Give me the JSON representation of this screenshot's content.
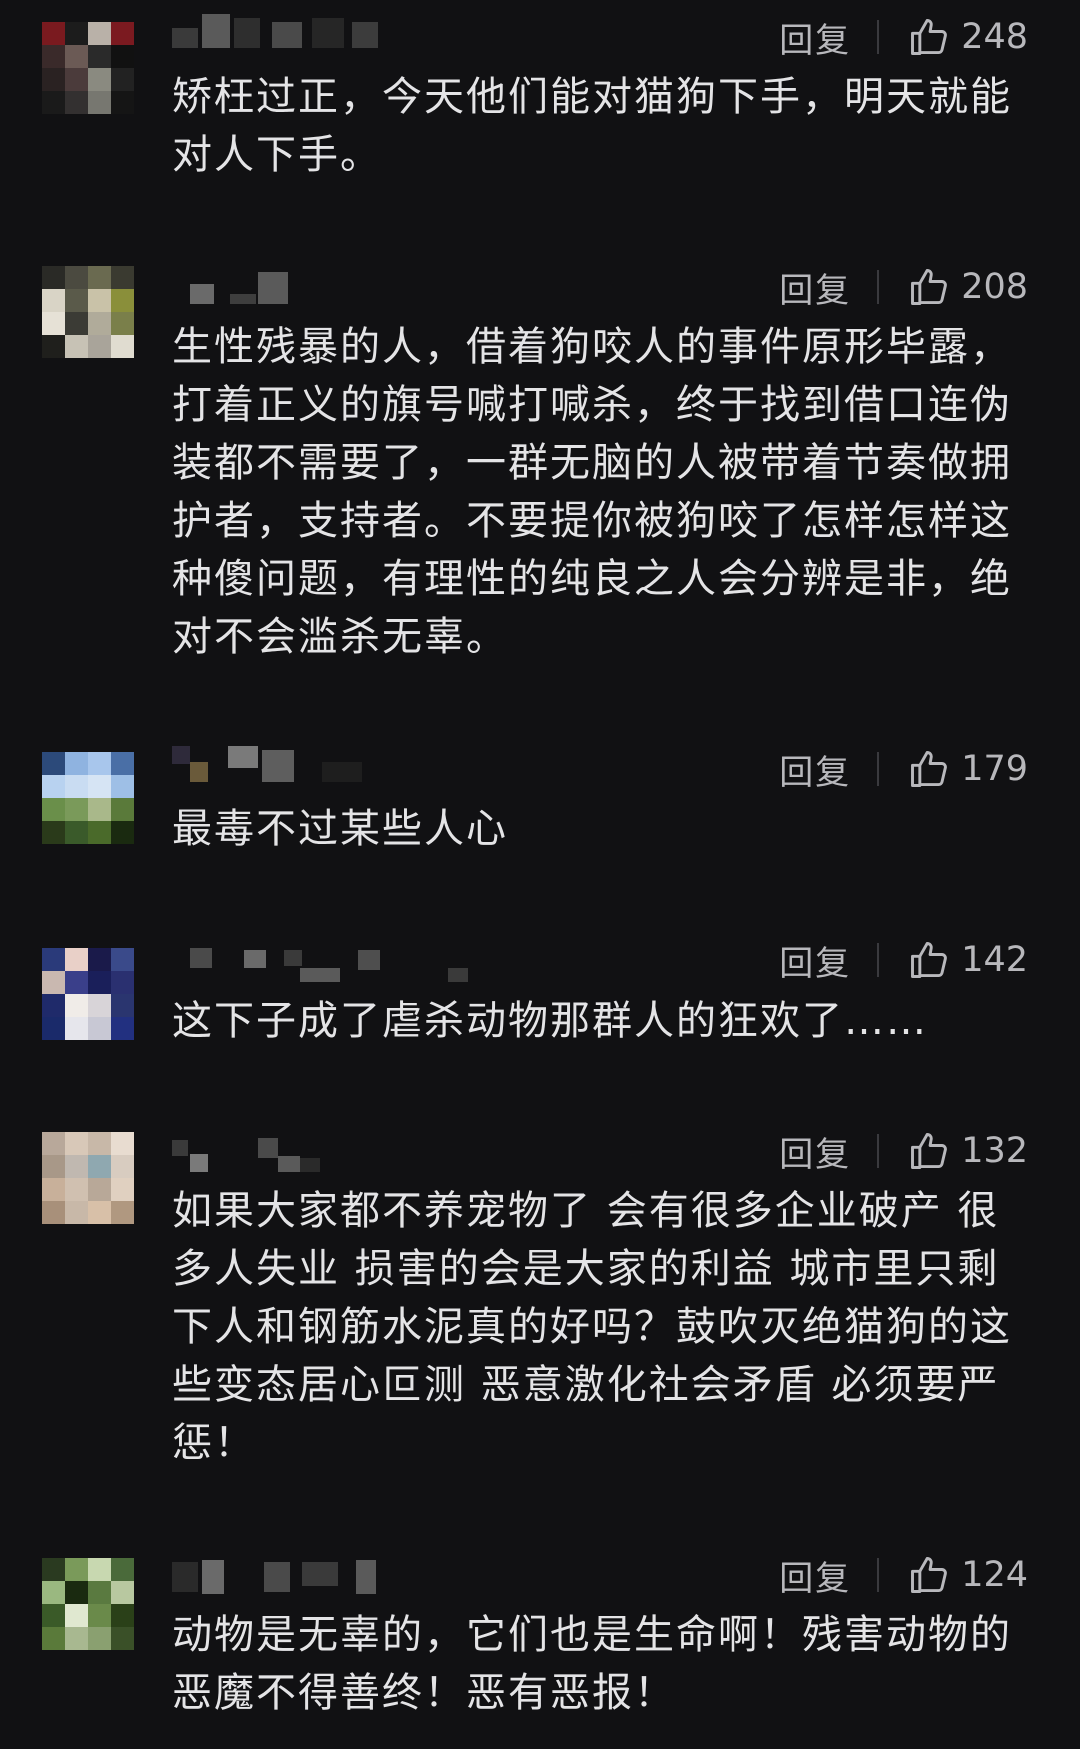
{
  "comments": [
    {
      "text": "矫枉过正，今天他们能对猫狗下手，明天就能对人下手。",
      "reply_label": "回复",
      "likes": "248",
      "avatar": [
        "#7a1a1f",
        "#1c1c1c",
        "#b9b1a8",
        "#7b1a20",
        "#3a2a2a",
        "#6b5a55",
        "#2a2a2a",
        "#111111",
        "#2a2222",
        "#4b3b3b",
        "#8a8a80",
        "#222222",
        "#1a1a1a",
        "#333030",
        "#777770",
        "#151515"
      ]
    },
    {
      "text": "生性残暴的人，借着狗咬人的事件原形毕露，打着正义的旗号喊打喊杀，终于找到借口连伪装都不需要了，一群无脑的人被带着节奏做拥护者，支持者。不要提你被狗咬了怎样怎样这种傻问题，有理性的纯良之人会分辨是非，绝对不会滥杀无辜。",
      "reply_label": "回复",
      "likes": "208",
      "avatar": [
        "#2a2a26",
        "#4b4a40",
        "#6a6a50",
        "#3a3a30",
        "#d9d4c6",
        "#5a5a4a",
        "#c9c2a8",
        "#8a8f3a",
        "#e6e1d6",
        "#3b3b35",
        "#b0ab9a",
        "#7a7f4a",
        "#1f1f1c",
        "#c7c2b5",
        "#a9a49a",
        "#e0dcd0"
      ]
    },
    {
      "text": "最毒不过某些人心",
      "reply_label": "回复",
      "likes": "179",
      "avatar": [
        "#2c4a7a",
        "#8fb3e0",
        "#a8c6ec",
        "#4a6fa6",
        "#b8d2f0",
        "#c9dcf2",
        "#d6e4f4",
        "#9ebfe6",
        "#6a8f4a",
        "#7a9a5a",
        "#a9b88a",
        "#5a7a3a",
        "#2a3a1a",
        "#3a5a2a",
        "#4a6a2a",
        "#1a2a10"
      ]
    },
    {
      "text": "这下子成了虐杀动物那群人的狂欢了……",
      "reply_label": "回复",
      "likes": "142",
      "avatar": [
        "#2a3a7a",
        "#e9d0c8",
        "#1a1a4a",
        "#3a4a8a",
        "#c9b8b0",
        "#3a3f8a",
        "#1a1f5a",
        "#2a3070",
        "#1f2a6a",
        "#f0ece8",
        "#d8d4d8",
        "#2a356f",
        "#1a2a6a",
        "#e6e6ec",
        "#c8c8d4",
        "#223080"
      ]
    },
    {
      "text": "如果大家都不养宠物了 会有很多企业破产 很多人失业 损害的会是大家的利益 城市里只剩下人和钢筋水泥真的好吗？鼓吹灭绝猫狗的这些变态居心叵测 恶意激化社会矛盾 必须要严惩！",
      "reply_label": "回复",
      "likes": "132",
      "avatar": [
        "#b8a89a",
        "#d8c8b8",
        "#c8b8a8",
        "#e8dcd0",
        "#a89888",
        "#c0b8b0",
        "#8fa8b0",
        "#d8ccc0",
        "#c8b09a",
        "#d0c0b0",
        "#b8a898",
        "#e0d0c0",
        "#a8907a",
        "#c8b8a8",
        "#d8c0a8",
        "#b09880"
      ]
    },
    {
      "text": "动物是无辜的，它们也是生命啊！残害动物的恶魔不得善终！恶有恶报！",
      "reply_label": "回复",
      "likes": "124",
      "avatar": [
        "#2a3a20",
        "#7a9a5a",
        "#c8d8b0",
        "#4a6a3a",
        "#9ab880",
        "#1a2a10",
        "#5a7a40",
        "#b8c8a0",
        "#3a5a28",
        "#e0e8d0",
        "#6a8a4a",
        "#2a4018",
        "#5a7a3a",
        "#a8b890",
        "#8aa070",
        "#3a5028"
      ]
    }
  ],
  "icons": {
    "like": "thumbs-up-icon"
  },
  "colors": {
    "background": "#111113",
    "text": "#e4e4e6",
    "meta": "#b8b8bc"
  }
}
